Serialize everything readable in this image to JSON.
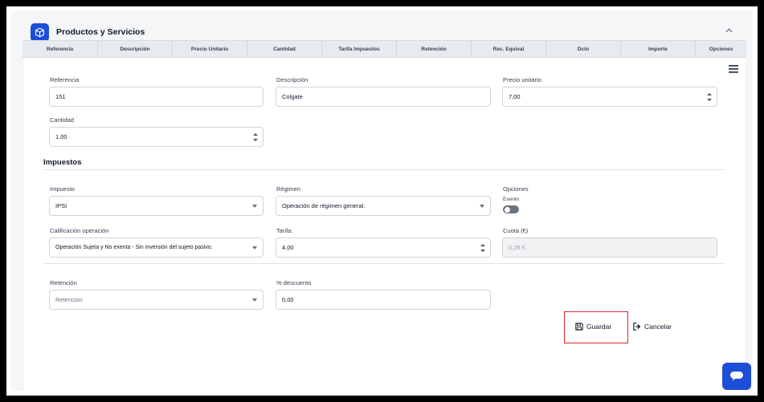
{
  "header": {
    "title": "Productos y Servicios",
    "logo_icon": "package-icon",
    "collapse_icon": "chevron-up-icon"
  },
  "toolbar": {
    "menu_icon": "hamburger-menu-icon"
  },
  "table": {
    "columns": [
      "Referencia",
      "Descripción",
      "Precio Unitario",
      "Cantidad",
      "Tarifa Impuestos",
      "Retención",
      "Rec. Equival",
      "Dcto",
      "Importe",
      "Opciones"
    ]
  },
  "form": {
    "referencia": {
      "label": "Referencia",
      "value": "151"
    },
    "descripcion": {
      "label": "Descripción",
      "value": "Colgate"
    },
    "precio_unitario": {
      "label": "Precio unitario",
      "value": "7,00"
    },
    "cantidad": {
      "label": "Cantidad",
      "value": "1,00"
    }
  },
  "impuestos": {
    "section_title": "Impuestos",
    "impuesto": {
      "label": "Impuesto",
      "value": "IPSI"
    },
    "regimen": {
      "label": "Régimen",
      "value": "Operación de régimen general."
    },
    "opciones": {
      "label": "Opciones",
      "exento_label": "Exento",
      "exento_checked": false
    },
    "calificacion": {
      "label": "Calificación operación",
      "value": "Operación Sujeta y No exenta - Sin inversión del sujeto pasivo."
    },
    "tarifa": {
      "label": "Tarifa:",
      "value": "4,00"
    },
    "cuota": {
      "label": "Cuota (€)",
      "value": "0,28 €"
    }
  },
  "extras": {
    "retencion": {
      "label": "Retención",
      "value": "Retención"
    },
    "descuento": {
      "label": "% descuento",
      "value": "0,00"
    }
  },
  "actions": {
    "save_label": "Guardar",
    "save_icon": "floppy-disk-icon",
    "cancel_label": "Cancelar",
    "cancel_icon": "sign-out-icon"
  },
  "colors": {
    "accent": "#1d4ed8",
    "highlight_border": "#d62828",
    "table_header_bg": "#e7eaee"
  }
}
